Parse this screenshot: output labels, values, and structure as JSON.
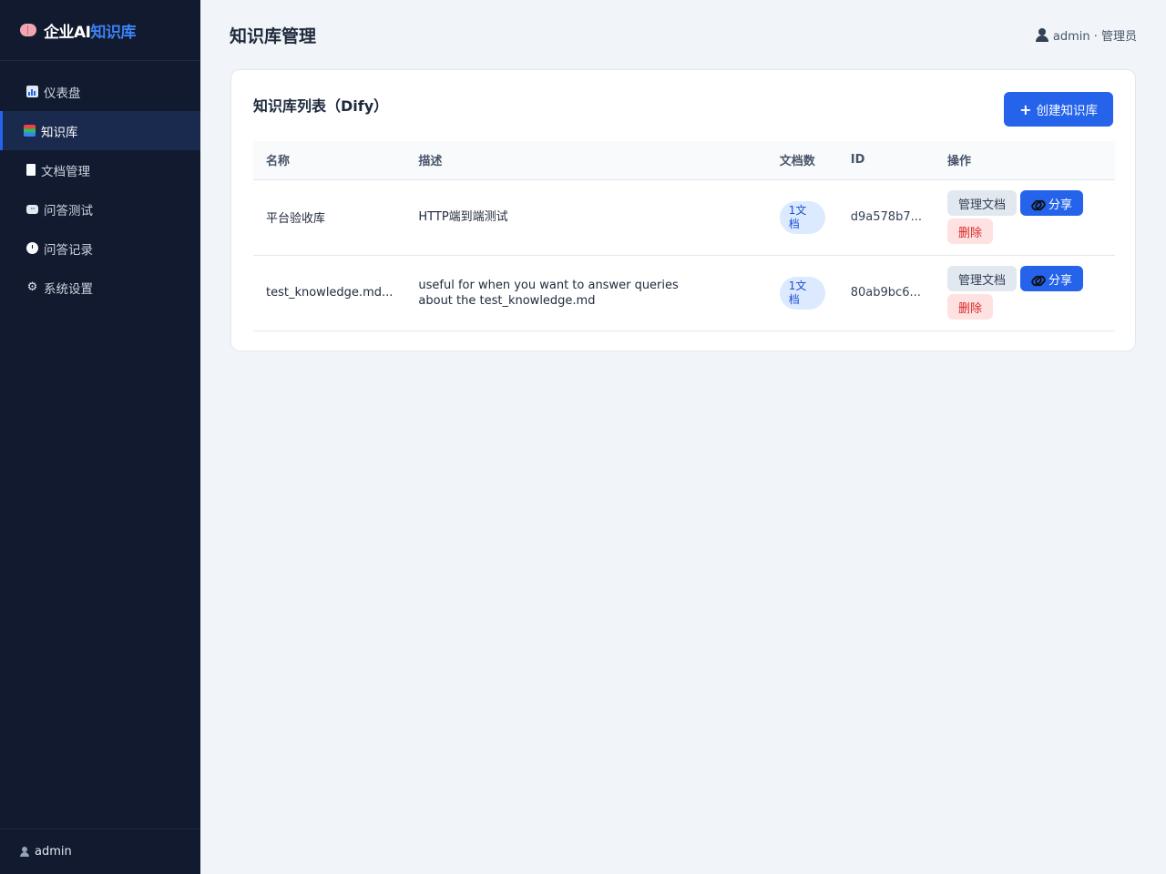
{
  "brand": {
    "prefix": "企业AI",
    "accent": "知识库",
    "icon": "brain-icon"
  },
  "sidebar": {
    "items": [
      {
        "label": "仪表盘",
        "icon": "chart-icon"
      },
      {
        "label": "知识库",
        "icon": "books-icon",
        "active": true
      },
      {
        "label": "文档管理",
        "icon": "document-icon"
      },
      {
        "label": "问答测试",
        "icon": "chat-icon"
      },
      {
        "label": "问答记录",
        "icon": "clock-icon"
      },
      {
        "label": "系统设置",
        "icon": "gear-icon"
      }
    ],
    "footer_user": "admin"
  },
  "header": {
    "title": "知识库管理",
    "user": "admin · 管理员"
  },
  "card": {
    "title": "知识库列表（Dify）",
    "create_button": "创建知识库",
    "create_icon": "+"
  },
  "table": {
    "columns": [
      "名称",
      "描述",
      "文档数",
      "ID",
      "操作"
    ],
    "rows": [
      {
        "name": "平台验收库",
        "description": "HTTP端到端测试",
        "doc_count": "1文档",
        "id": "d9a578b7...",
        "actions": {
          "manage": "管理文档",
          "share": "分享",
          "delete": "删除"
        }
      },
      {
        "name": "test_knowledge.md...",
        "description": "useful for when you want to answer queries about the test_knowledge.md",
        "doc_count": "1文档",
        "id": "80ab9bc6...",
        "actions": {
          "manage": "管理文档",
          "share": "分享",
          "delete": "删除"
        }
      }
    ]
  },
  "colors": {
    "sidebar_bg": "#111a2e",
    "primary": "#2563eb",
    "danger": "#dc2626",
    "page_bg": "#f1f5f9"
  }
}
